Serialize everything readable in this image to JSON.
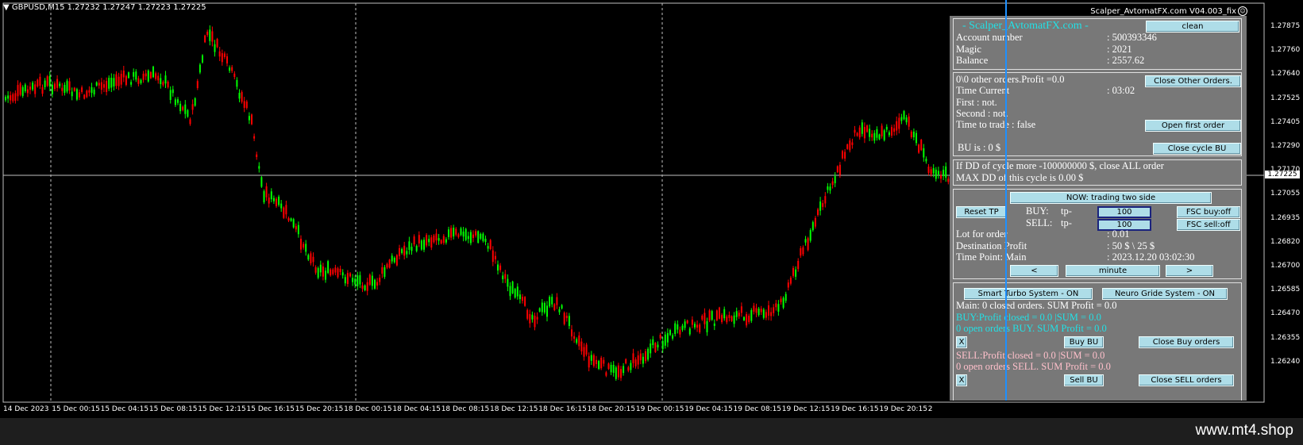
{
  "symbol": "GBPUSD,M15  1.27232 1.27247 1.27223 1.27225",
  "ea_name": "Scalper_AvtomatFX.com  V04.003_fix",
  "price_scale": [
    "1.27875",
    "1.27760",
    "1.27640",
    "1.27525",
    "1.27405",
    "1.27290",
    "1.27170",
    "1.27055",
    "1.26935",
    "1.26820",
    "1.26700",
    "1.26585",
    "1.26470",
    "1.26355",
    "1.26240"
  ],
  "current_price": "1.27225",
  "time_scale": [
    "14 Dec 2023",
    "15 Dec 00:15",
    "15 Dec 04:15",
    "15 Dec 08:15",
    "15 Dec 12:15",
    "15 Dec 16:15",
    "15 Dec 20:15",
    "18 Dec 00:15",
    "18 Dec 04:15",
    "18 Dec 08:15",
    "18 Dec 12:15",
    "18 Dec 16:15",
    "18 Dec 20:15",
    "19 Dec 00:15",
    "19 Dec 04:15",
    "19 Dec 08:15",
    "19 Dec 12:15",
    "19 Dec 16:15",
    "19 Dec 20:15",
    "2"
  ],
  "colors": {
    "bull": "#00ff00",
    "bear": "#ff0000",
    "panel": "#787878",
    "button": "#aedde8",
    "cursor": "#1e90ff"
  },
  "panel": {
    "header": {
      "title": "- Scalper_AvtomatFX.com -",
      "clean_button": "clean",
      "rows": [
        {
          "label": "Account number",
          "value": ": 500393346"
        },
        {
          "label": "Magic",
          "value": ": 2021"
        },
        {
          "label": "Balance",
          "value": ": 2557.62"
        }
      ]
    },
    "status": {
      "other_orders": "0\\0 other orders.Profit =0.0",
      "close_other_button": "Close Other Orders.",
      "time_current_label": "Time Current",
      "time_current_value": ": 03:02",
      "first": "First      : not.",
      "second": "Second  : not.",
      "time_to_trade": "Time to trade :  false",
      "open_first_button": "Open first order",
      "bu_is": "BU is :  0 $",
      "close_cycle_button": "Close cycle BU"
    },
    "dd": {
      "line1": "If DD of cycle more -100000000 $, close ALL order",
      "line2": "MAX DD of this cycle is 0.00 $"
    },
    "trade": {
      "mode_button": "NOW: trading two side",
      "reset_tp_button": "Reset TP",
      "buy_label": "BUY:",
      "buy_tp_label": "tp-",
      "buy_tp_value": "100",
      "fsc_buy_button": "FSC buy:off",
      "sell_label": "SELL:",
      "sell_tp_label": "tp-",
      "sell_tp_value": "100",
      "fsc_sell_button": "FSC sell:off",
      "lot_label": "Lot for order",
      "lot_value": ": 0.01",
      "dest_label": "Destination Profit",
      "dest_value": ": 50 $ \\ 25 $",
      "timepoint_label": "Time Point: Main",
      "timepoint_value": ": 2023.12.20 03:02:30",
      "prev_button": "<",
      "period_button": "minute",
      "next_button": ">"
    },
    "systems": {
      "smart_turbo_button": "Smart Turbo System - ON",
      "neuro_grid_button": "Neuro Gride System - ON",
      "main_summary": "Main: 0 closed orders. SUM Profit = 0.0",
      "buy_closed": "BUY:Profit closed = 0.0  |SUM = 0.0",
      "buy_open": "0 open orders BUY. SUM Profit = 0.0",
      "x_button": "X",
      "buy_bu_button": "Buy BU",
      "close_buy_button": "Close Buy orders",
      "sell_closed": "SELL:Profit closed = 0.0  |SUM = 0.0",
      "sell_open": "0 open orders SELL. SUM Profit = 0.0",
      "x2_button": "X",
      "sell_bu_button": "Sell BU",
      "close_sell_button": "Close SELL orders"
    }
  },
  "footer_brand": "www.mt4.shop"
}
